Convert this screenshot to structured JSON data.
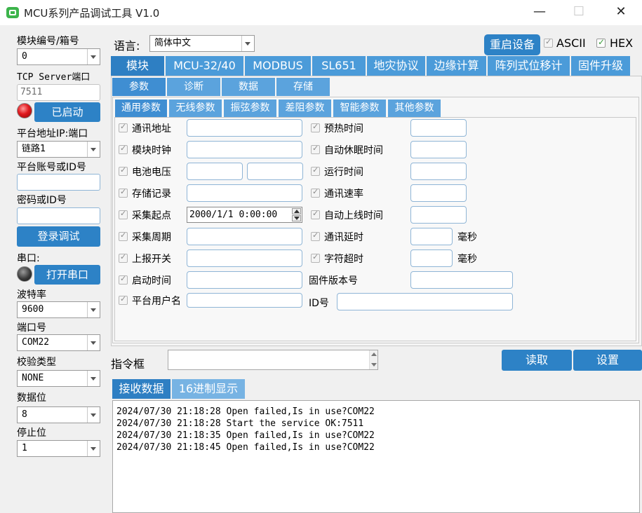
{
  "window": {
    "title": "MCU系列产品调试工具 V1.0",
    "minimize": "—",
    "maximize": "☐",
    "close": "✕"
  },
  "left": {
    "module_label": "模块编号/箱号",
    "module_value": "0",
    "tcp_label": "TCP Server端口",
    "tcp_port": "7511",
    "started_btn": "已启动",
    "platform_addr_label": "平台地址IP:端口",
    "link_value": "链路1",
    "account_label": "平台账号或ID号",
    "account_value": "",
    "password_label": "密码或ID号",
    "password_value": "",
    "login_btn": "登录调试",
    "serial_label": "串口:",
    "open_serial_btn": "打开串口",
    "baud_label": "波特率",
    "baud_value": "9600",
    "port_label": "端口号",
    "port_value": "COM22",
    "parity_label": "校验类型",
    "parity_value": "NONE",
    "databits_label": "数据位",
    "databits_value": "8",
    "stopbits_label": "停止位",
    "stopbits_value": "1"
  },
  "top": {
    "language_label": "语言:",
    "language_value": "简体中文",
    "restart_btn": "重启设备",
    "ascii_label": "ASCII",
    "ascii_checked": false,
    "hex_label": "HEX",
    "hex_checked": true
  },
  "main_tabs": [
    "模块",
    "MCU-32/40",
    "MODBUS",
    "SL651",
    "地灾协议",
    "边缘计算",
    "阵列式位移计",
    "固件升级"
  ],
  "sub_tabs": [
    "参数",
    "诊断",
    "数据",
    "存储"
  ],
  "param_tabs": [
    "通用参数",
    "无线参数",
    "振弦参数",
    "差阻参数",
    "智能参数",
    "其他参数"
  ],
  "params_left": [
    "通讯地址",
    "模块时钟",
    "电池电压",
    "存储记录",
    "采集起点",
    "采集周期",
    "上报开关",
    "启动时间",
    "平台用户名"
  ],
  "collect_start_value": "2000/1/1 0:00:00",
  "params_right": [
    "预热时间",
    "自动休眠时间",
    "运行时间",
    "通讯速率",
    "自动上线时间",
    "通讯延时",
    "字符超时"
  ],
  "unit_ms": "毫秒",
  "firmware_label": "固件版本号",
  "id_label": "ID号",
  "command": {
    "label": "指令框",
    "value": "",
    "read_btn": "读取",
    "set_btn": "设置"
  },
  "bottom_tabs": [
    "接收数据",
    "16进制显示"
  ],
  "log_lines": [
    "2024/07/30 21:18:28 Open failed,Is in use?COM22",
    "2024/07/30 21:18:28 Start the service OK:7511",
    "2024/07/30 21:18:35 Open failed,Is in use?COM22",
    "2024/07/30 21:18:45 Open failed,Is in use?COM22"
  ],
  "colors": {
    "tab_blue": "#4b9bd9",
    "button_blue": "#2d82c6",
    "led_red": "#e0191e",
    "led_off": "#3a3a3a"
  }
}
